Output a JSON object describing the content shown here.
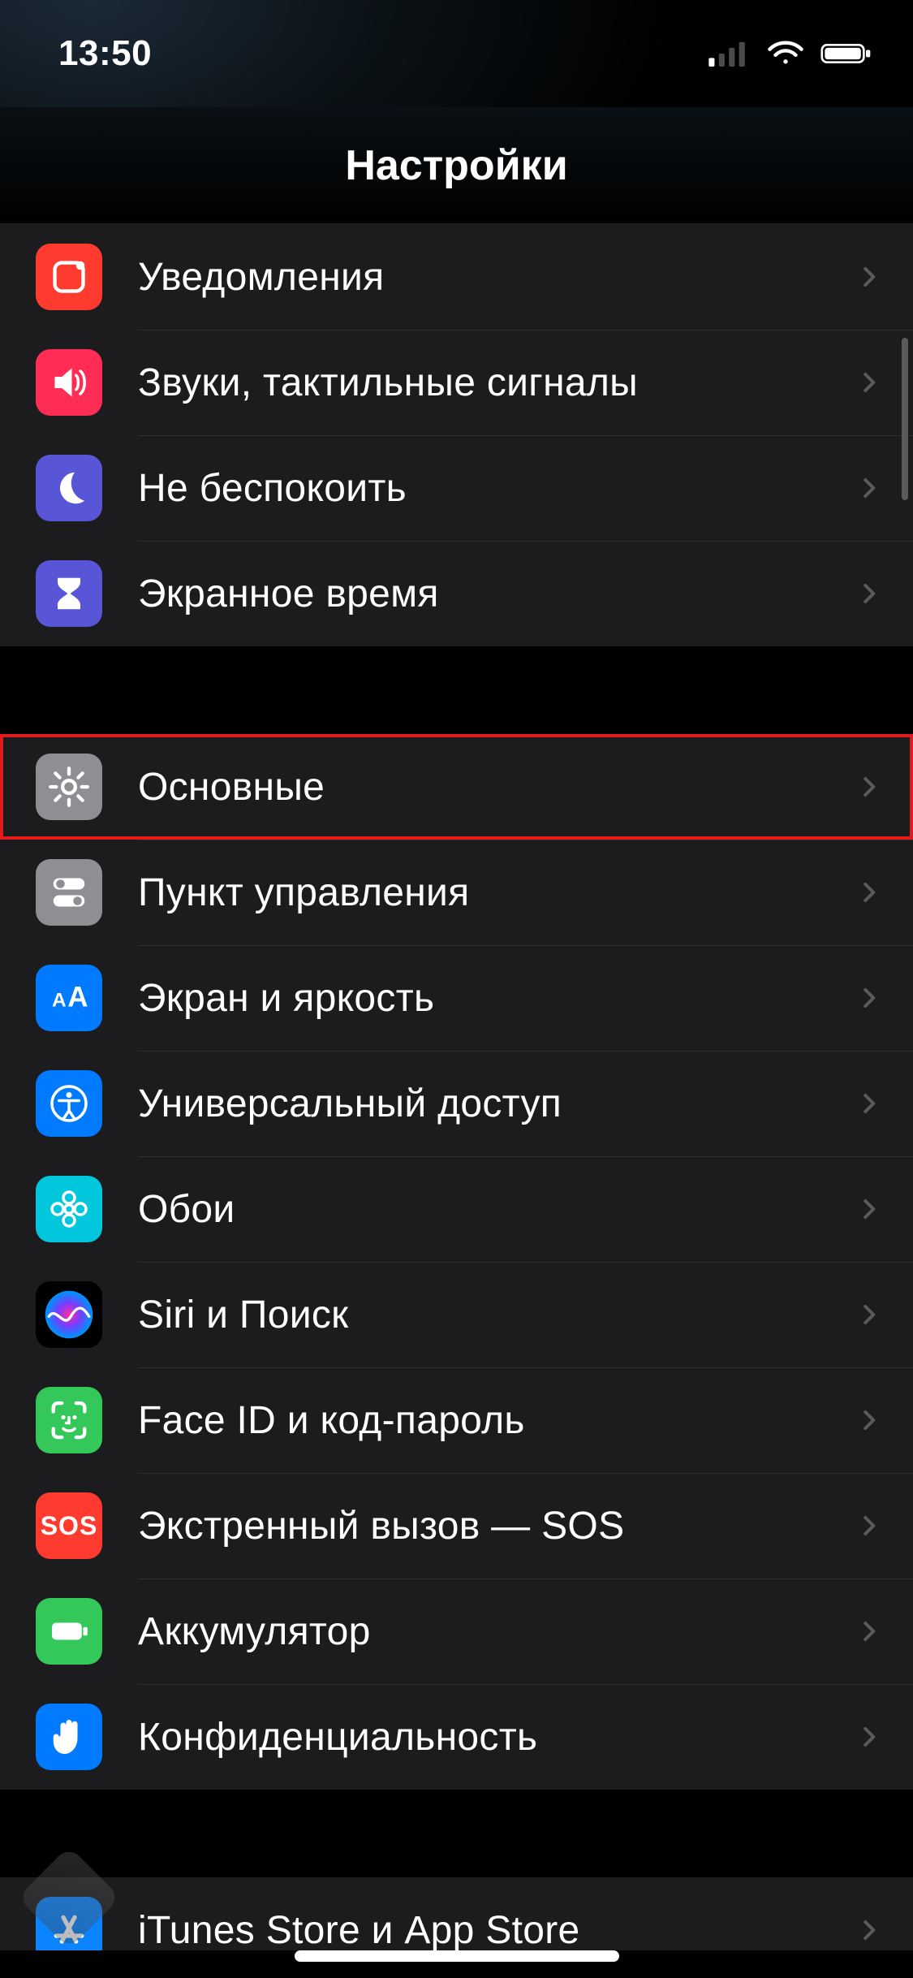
{
  "status": {
    "time": "13:50"
  },
  "nav": {
    "title": "Настройки"
  },
  "groups": [
    {
      "rows": [
        {
          "id": "notifications",
          "label": "Уведомления",
          "icon": "notifications-icon",
          "icon_bg": "#ff3b30",
          "highlight": false
        },
        {
          "id": "sounds",
          "label": "Звуки, тактильные сигналы",
          "icon": "sounds-icon",
          "icon_bg": "#ff2d55",
          "highlight": false
        },
        {
          "id": "do-not-disturb",
          "label": "Не беспокоить",
          "icon": "moon-icon",
          "icon_bg": "#5856d6",
          "highlight": false
        },
        {
          "id": "screen-time",
          "label": "Экранное время",
          "icon": "hourglass-icon",
          "icon_bg": "#5856d6",
          "highlight": false
        }
      ]
    },
    {
      "rows": [
        {
          "id": "general",
          "label": "Основные",
          "icon": "gear-icon",
          "icon_bg": "#8e8e93",
          "highlight": true
        },
        {
          "id": "control-center",
          "label": "Пункт управления",
          "icon": "switches-icon",
          "icon_bg": "#8e8e93",
          "highlight": false
        },
        {
          "id": "display",
          "label": "Экран и яркость",
          "icon": "text-size-icon",
          "icon_bg": "#007aff",
          "highlight": false
        },
        {
          "id": "accessibility",
          "label": "Универсальный доступ",
          "icon": "accessibility-icon",
          "icon_bg": "#007aff",
          "highlight": false
        },
        {
          "id": "wallpaper",
          "label": "Обои",
          "icon": "wallpaper-icon",
          "icon_bg": "#00c7dc",
          "highlight": false
        },
        {
          "id": "siri",
          "label": "Siri и Поиск",
          "icon": "siri-icon",
          "icon_bg": "#000000",
          "highlight": false
        },
        {
          "id": "faceid",
          "label": "Face ID и код-пароль",
          "icon": "faceid-icon",
          "icon_bg": "#34c759",
          "highlight": false
        },
        {
          "id": "sos",
          "label": "Экстренный вызов — SOS",
          "icon": "sos-icon",
          "icon_bg": "#ff3b30",
          "highlight": false
        },
        {
          "id": "battery",
          "label": "Аккумулятор",
          "icon": "battery-icon",
          "icon_bg": "#34c759",
          "highlight": false
        },
        {
          "id": "privacy",
          "label": "Конфиденциальность",
          "icon": "hand-icon",
          "icon_bg": "#007aff",
          "highlight": false
        }
      ]
    },
    {
      "rows": [
        {
          "id": "itunes",
          "label": "iTunes Store и App Store",
          "icon": "appstore-icon",
          "icon_bg": "#0a84ff",
          "highlight": false
        }
      ]
    }
  ]
}
